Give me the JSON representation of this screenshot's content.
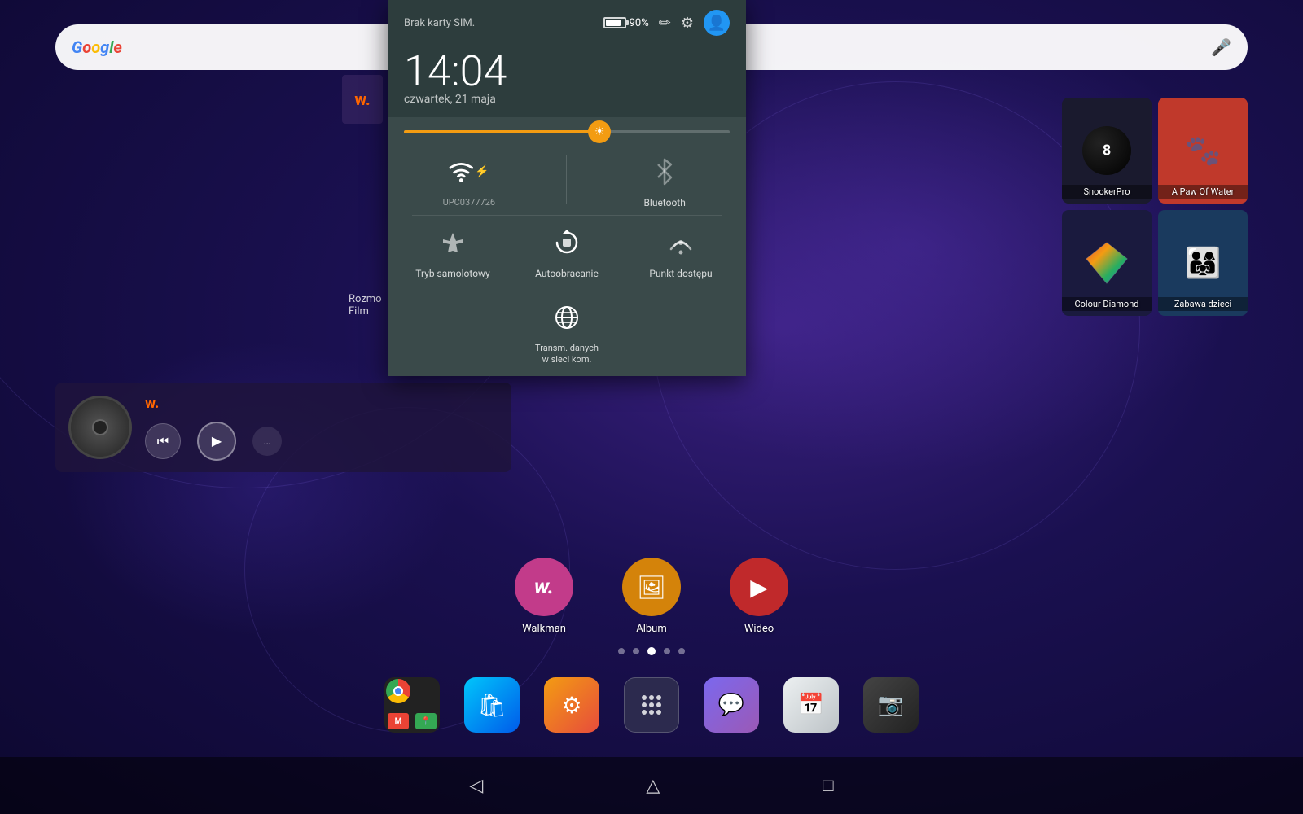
{
  "wallpaper": {
    "alt": "Purple gradient wallpaper"
  },
  "google_bar": {
    "logo": "Google",
    "placeholder": "",
    "mic_icon": "mic"
  },
  "notification_panel": {
    "sim_status": "Brak karty SIM.",
    "battery_percent": "90%",
    "time": "14:04",
    "date": "czwartek, 21 maja",
    "wifi_network": "UPC0377726",
    "wifi_label": "UPC0377726",
    "bluetooth_label": "Bluetooth",
    "airplane_label": "Tryb samolotowy",
    "rotate_label": "Autoobracanie",
    "hotspot_label": "Punkt dostępu",
    "data_label": "Transm. danych w sieci kom.",
    "icons": {
      "pencil": "✏",
      "gear": "⚙",
      "avatar": "person"
    }
  },
  "app_tiles": [
    {
      "label": "SnookerPro",
      "type": "snooker"
    },
    {
      "label": "A Paw Of Water",
      "type": "paw"
    },
    {
      "label": "Colour Diamond",
      "type": "diamond"
    },
    {
      "label": "Zabawa dzieci",
      "type": "zabawa"
    }
  ],
  "music_player": {
    "app_logo": "w.",
    "prev_icon": "⏮",
    "play_icon": "▶",
    "extra_icon": "…"
  },
  "home_apps": [
    {
      "name": "Walkman",
      "icon": "w",
      "color_class": "icon-walkman"
    },
    {
      "name": "Album",
      "icon": "🖼",
      "color_class": "icon-album"
    },
    {
      "name": "Wideo",
      "icon": "▶",
      "color_class": "icon-wideo"
    }
  ],
  "page_dots": {
    "count": 5,
    "active": 2
  },
  "dock_items": [
    {
      "name": "chrome-gmail-maps",
      "label": ""
    },
    {
      "name": "play-store",
      "label": ""
    },
    {
      "name": "settings",
      "label": ""
    },
    {
      "name": "app-drawer",
      "label": ""
    },
    {
      "name": "messaging",
      "label": ""
    },
    {
      "name": "calendar",
      "label": ""
    },
    {
      "name": "camera",
      "label": ""
    }
  ],
  "nav_bar": {
    "back_icon": "◁",
    "home_icon": "△",
    "recent_icon": "□"
  },
  "partial_content": {
    "rozmo": "Rozmo",
    "film": "Film"
  }
}
